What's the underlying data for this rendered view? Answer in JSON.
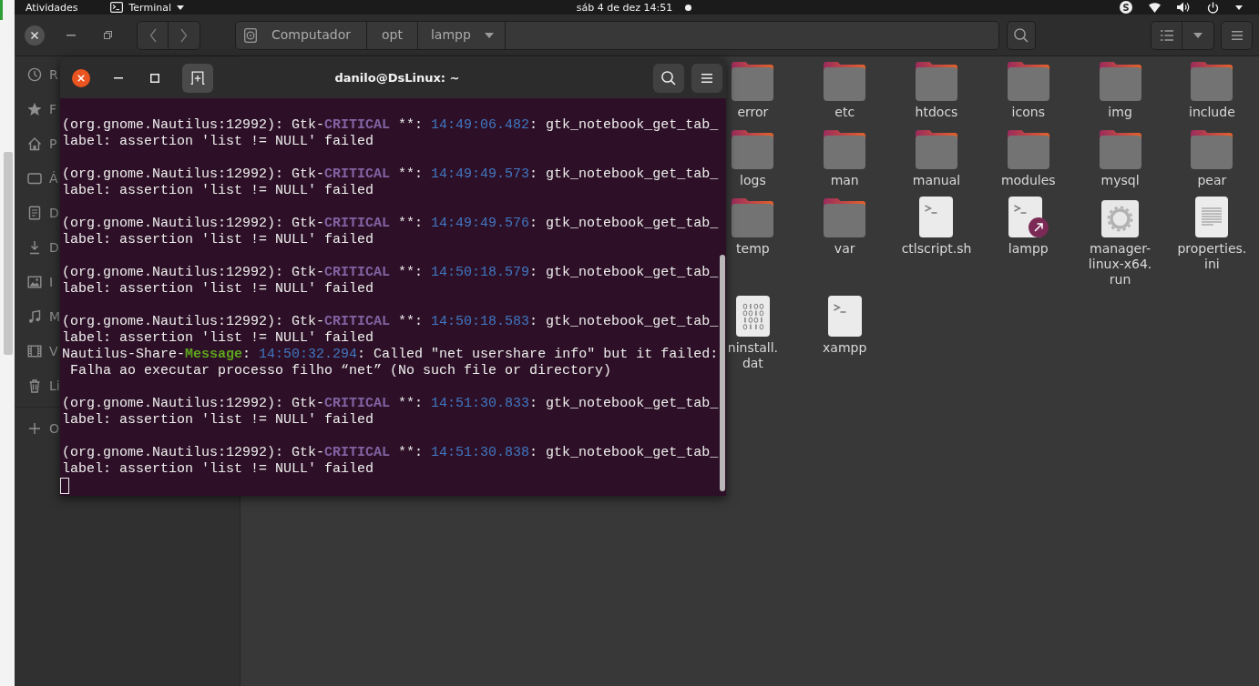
{
  "top_bar": {
    "activities": "Atividades",
    "app_menu": "Terminal",
    "clock": "sáb 4 de dez 14:51"
  },
  "file_manager": {
    "path": [
      {
        "label": "Computador",
        "kind": "drive"
      },
      {
        "label": "opt",
        "kind": "folder"
      },
      {
        "label": "lampp",
        "kind": "current"
      }
    ],
    "sidebar": {
      "places": [
        {
          "label": "R",
          "kind": "recent"
        },
        {
          "label": "F",
          "kind": "starred"
        },
        {
          "label": "P",
          "kind": "home"
        },
        {
          "label": "Á",
          "kind": "desktop"
        },
        {
          "label": "D",
          "kind": "documents"
        },
        {
          "label": "D",
          "kind": "downloads"
        },
        {
          "label": "I",
          "kind": "pictures"
        },
        {
          "label": "M",
          "kind": "music"
        },
        {
          "label": "V",
          "kind": "videos"
        },
        {
          "label": "Li",
          "kind": "trash"
        }
      ],
      "other_locations": {
        "label": "O"
      }
    },
    "files": [
      {
        "name": "error",
        "kind": "folder"
      },
      {
        "name": "etc",
        "kind": "folder"
      },
      {
        "name": "htdocs",
        "kind": "folder"
      },
      {
        "name": "icons",
        "kind": "folder"
      },
      {
        "name": "img",
        "kind": "folder"
      },
      {
        "name": "include",
        "kind": "folder"
      },
      {
        "name": "logs",
        "kind": "folder"
      },
      {
        "name": "man",
        "kind": "folder"
      },
      {
        "name": "manual",
        "kind": "folder"
      },
      {
        "name": "modules",
        "kind": "folder"
      },
      {
        "name": "mysql",
        "kind": "folder"
      },
      {
        "name": "pear",
        "kind": "folder"
      },
      {
        "name": "temp",
        "kind": "folder"
      },
      {
        "name": "var",
        "kind": "folder"
      },
      {
        "name": "ctlscript.sh",
        "kind": "script"
      },
      {
        "name": "lampp",
        "kind": "script-link"
      },
      {
        "name": "manager-linux-x64.run",
        "kind": "executable"
      },
      {
        "name": "properties.ini",
        "kind": "document"
      },
      {
        "name": "ninstall.dat",
        "kind": "binary"
      },
      {
        "name": "xampp",
        "kind": "script"
      }
    ]
  },
  "terminal": {
    "title": "danilo@DsLinux: ~",
    "log": [
      {
        "kind": "critical",
        "source": "(org.gnome.Nautilus:12992): Gtk-",
        "severity": "CRITICAL",
        "marker": " **: ",
        "time": "14:49:06.482",
        "message": ": gtk_notebook_get_tab_label: assertion 'list != NULL' failed"
      },
      {
        "kind": "critical",
        "source": "(org.gnome.Nautilus:12992): Gtk-",
        "severity": "CRITICAL",
        "marker": " **: ",
        "time": "14:49:49.573",
        "message": ": gtk_notebook_get_tab_label: assertion 'list != NULL' failed"
      },
      {
        "kind": "critical",
        "source": "(org.gnome.Nautilus:12992): Gtk-",
        "severity": "CRITICAL",
        "marker": " **: ",
        "time": "14:49:49.576",
        "message": ": gtk_notebook_get_tab_label: assertion 'list != NULL' failed"
      },
      {
        "kind": "critical",
        "source": "(org.gnome.Nautilus:12992): Gtk-",
        "severity": "CRITICAL",
        "marker": " **: ",
        "time": "14:50:18.579",
        "message": ": gtk_notebook_get_tab_label: assertion 'list != NULL' failed"
      },
      {
        "kind": "critical",
        "source": "(org.gnome.Nautilus:12992): Gtk-",
        "severity": "CRITICAL",
        "marker": " **: ",
        "time": "14:50:18.583",
        "message": ": gtk_notebook_get_tab_label: assertion 'list != NULL' failed"
      },
      {
        "kind": "message",
        "source": "Nautilus-Share-",
        "severity": "Message",
        "marker": ": ",
        "time": "14:50:32.294",
        "message": ": Called \"net usershare info\" but it failed:",
        "detail": " Falha ao executar processo filho “net” (No such file or directory)"
      },
      {
        "kind": "critical",
        "source": "(org.gnome.Nautilus:12992): Gtk-",
        "severity": "CRITICAL",
        "marker": " **: ",
        "time": "14:51:30.833",
        "message": ": gtk_notebook_get_tab_label: assertion 'list != NULL' failed"
      },
      {
        "kind": "critical",
        "source": "(org.gnome.Nautilus:12992): Gtk-",
        "severity": "CRITICAL",
        "marker": " **: ",
        "time": "14:51:30.838",
        "message": ": gtk_notebook_get_tab_label: assertion 'list != NULL' failed"
      }
    ]
  }
}
